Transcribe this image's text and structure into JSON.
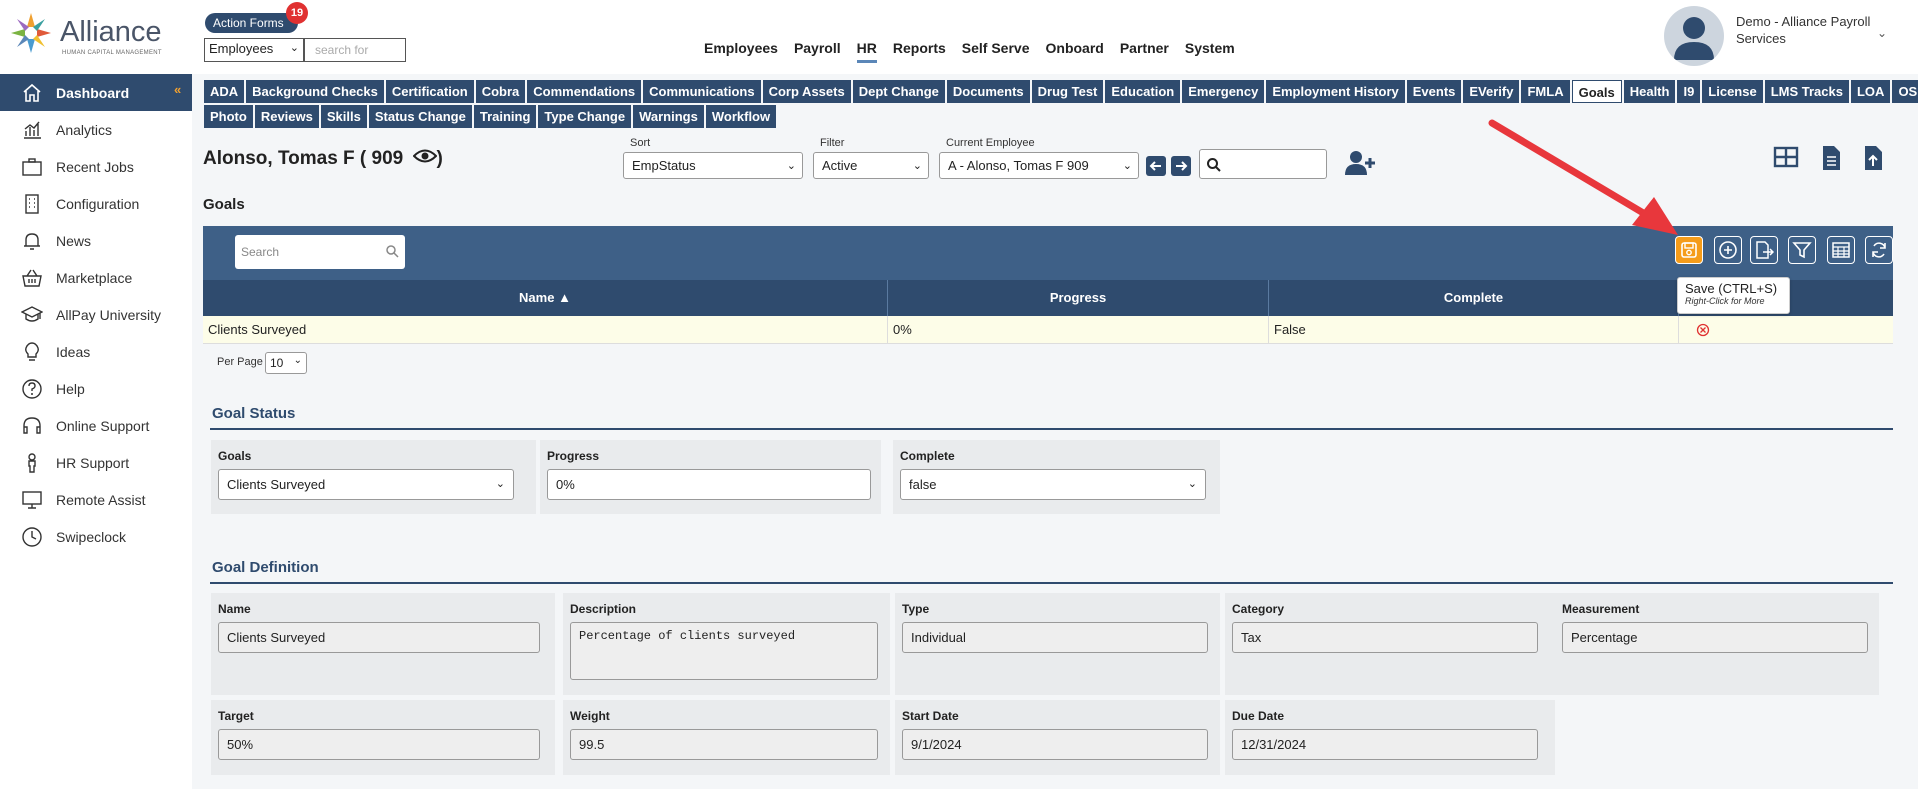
{
  "header": {
    "logo_text": "Alliance",
    "logo_sub": "HUMAN CAPITAL MANAGEMENT",
    "action_forms_label": "Action Forms",
    "action_forms_count": "19",
    "employee_select": "Employees",
    "search_placeholder": "search for",
    "nav": [
      "Employees",
      "Payroll",
      "HR",
      "Reports",
      "Self Serve",
      "Onboard",
      "Partner",
      "System"
    ],
    "active_nav": "HR",
    "user_name": "Demo - Alliance Payroll Services"
  },
  "sidebar": {
    "items": [
      {
        "label": "Dashboard",
        "icon": "home-icon",
        "active": true
      },
      {
        "label": "Analytics",
        "icon": "analytics-icon"
      },
      {
        "label": "Recent Jobs",
        "icon": "briefcase-icon"
      },
      {
        "label": "Configuration",
        "icon": "building-icon"
      },
      {
        "label": "News",
        "icon": "bell-icon"
      },
      {
        "label": "Marketplace",
        "icon": "basket-icon"
      },
      {
        "label": "AllPay University",
        "icon": "graduation-cap-icon"
      },
      {
        "label": "Ideas",
        "icon": "lightbulb-icon"
      },
      {
        "label": "Help",
        "icon": "question-icon"
      },
      {
        "label": "Online Support",
        "icon": "headset-icon"
      },
      {
        "label": "HR Support",
        "icon": "person-icon"
      },
      {
        "label": "Remote Assist",
        "icon": "monitor-icon"
      },
      {
        "label": "Swipeclock",
        "icon": "clock-icon"
      }
    ]
  },
  "tabs": {
    "row1": [
      "ADA",
      "Background Checks",
      "Certification",
      "Cobra",
      "Commendations",
      "Communications",
      "Corp Assets",
      "Dept Change",
      "Documents",
      "Drug Test",
      "Education",
      "Emergency",
      "Employment History",
      "Events",
      "EVerify",
      "FMLA",
      "Goals",
      "Health",
      "I9",
      "License",
      "LMS Tracks",
      "LOA",
      "OSHA"
    ],
    "row2": [
      "Photo",
      "Reviews",
      "Skills",
      "Status Change",
      "Training",
      "Type Change",
      "Warnings",
      "Workflow"
    ],
    "active": "Goals"
  },
  "employee": {
    "name": "Alonso, Tomas F ( 909",
    "name_suffix": ")",
    "sort_label": "Sort",
    "sort_value": "EmpStatus",
    "filter_label": "Filter",
    "filter_value": "Active",
    "current_label": "Current Employee",
    "current_value": "A - Alonso, Tomas F 909"
  },
  "goals": {
    "title": "Goals",
    "search_placeholder": "Search",
    "columns": [
      "Name ▲",
      "Progress",
      "Complete",
      ""
    ],
    "rows": [
      {
        "name": "Clients Surveyed",
        "progress": "0%",
        "complete": "False"
      }
    ],
    "per_page_label": "Per Page",
    "per_page_value": "10",
    "tooltip_title": "Save (CTRL+S)",
    "tooltip_sub": "Right-Click for More"
  },
  "goal_status": {
    "title": "Goal Status",
    "goals_label": "Goals",
    "goals_value": "Clients Surveyed",
    "progress_label": "Progress",
    "progress_value": "0%",
    "complete_label": "Complete",
    "complete_value": "false"
  },
  "goal_definition": {
    "title": "Goal Definition",
    "name_label": "Name",
    "name_value": "Clients Surveyed",
    "description_label": "Description",
    "description_value": "Percentage of clients surveyed",
    "type_label": "Type",
    "type_value": "Individual",
    "category_label": "Category",
    "category_value": "Tax",
    "measurement_label": "Measurement",
    "measurement_value": "Percentage",
    "target_label": "Target",
    "target_value": "50%",
    "weight_label": "Weight",
    "weight_value": "99.5",
    "start_label": "Start Date",
    "start_value": "9/1/2024",
    "due_label": "Due Date",
    "due_value": "12/31/2024"
  },
  "colors": {
    "navy": "#2f4b6e",
    "toolbar": "#3e6087",
    "save_orange": "#f59c1a",
    "arrow_red": "#e8373c"
  }
}
